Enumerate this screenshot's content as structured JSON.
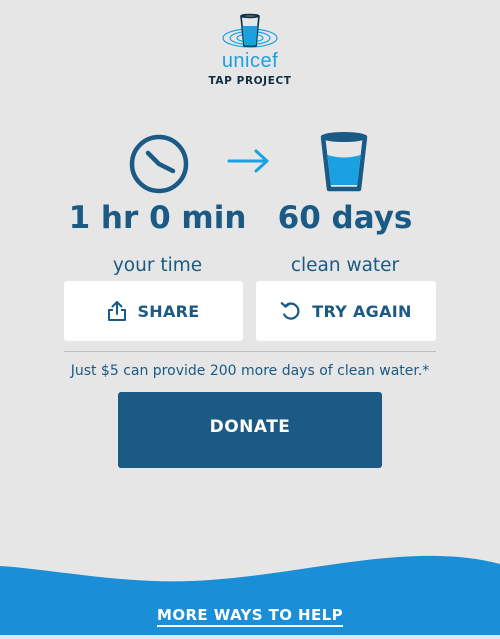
{
  "logo": {
    "wordmark": "unicef",
    "subtitle": "TAP PROJECT",
    "icon": "water-glass-ripple-icon"
  },
  "progress": {
    "clock_icon": "clock-icon",
    "arrow_icon": "arrow-right-icon",
    "glass_icon": "water-glass-icon"
  },
  "stats": {
    "time_value": "1 hr 0 min",
    "time_label": "your time",
    "water_value": "60 days",
    "water_label": "clean water"
  },
  "actions": {
    "share_label": "SHARE",
    "share_icon": "share-icon",
    "retry_label": "TRY AGAIN",
    "retry_icon": "refresh-icon"
  },
  "promo_text": "Just $5 can provide 200 more days of clean water.*",
  "donate_label": "DONATE",
  "footer": {
    "more_link": "MORE WAYS TO HELP"
  },
  "colors": {
    "background": "#e6e6e6",
    "primary": "#1a5a85",
    "accent": "#1ba1e2",
    "wave": "#1a8ed6",
    "button_bg": "#ffffff"
  }
}
